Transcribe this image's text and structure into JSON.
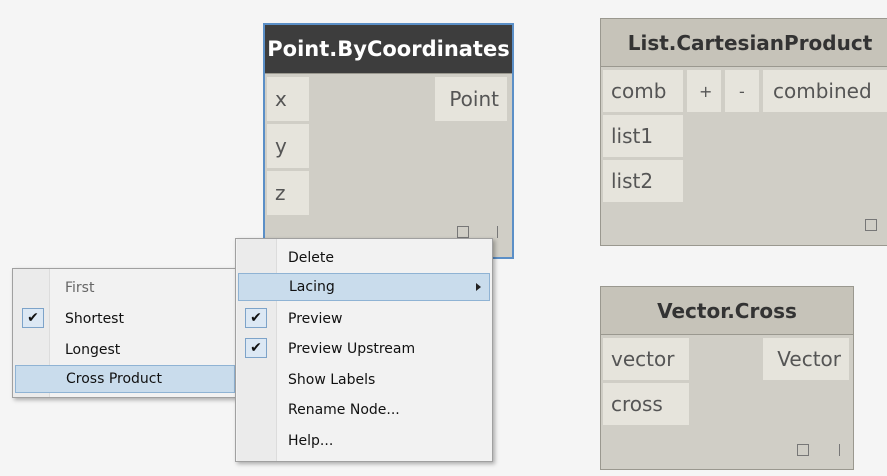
{
  "point_node": {
    "title": "Point.ByCoordinates",
    "inputs": [
      "x",
      "y",
      "z"
    ],
    "output": "Point"
  },
  "cartesian_node": {
    "title": "List.CartesianProduct",
    "inputs": [
      "comb",
      "list1",
      "list2"
    ],
    "add_label": "+",
    "remove_label": "-",
    "output": "combined"
  },
  "vector_node": {
    "title": "Vector.Cross",
    "inputs": [
      "vector",
      "cross"
    ],
    "output": "Vector"
  },
  "context_menu": {
    "items": [
      {
        "label": "Delete",
        "checked": false
      },
      {
        "label": "Lacing",
        "checked": false,
        "submenu": true
      },
      {
        "label": "Preview",
        "checked": true
      },
      {
        "label": "Preview Upstream",
        "checked": true
      },
      {
        "label": "Show Labels",
        "checked": false
      },
      {
        "label": "Rename Node...",
        "checked": false
      },
      {
        "label": "Help...",
        "checked": false
      }
    ]
  },
  "lacing_menu": {
    "items": [
      {
        "label": "First",
        "checked": false
      },
      {
        "label": "Shortest",
        "checked": true
      },
      {
        "label": "Longest",
        "checked": false
      },
      {
        "label": "Cross Product",
        "checked": false
      }
    ]
  }
}
